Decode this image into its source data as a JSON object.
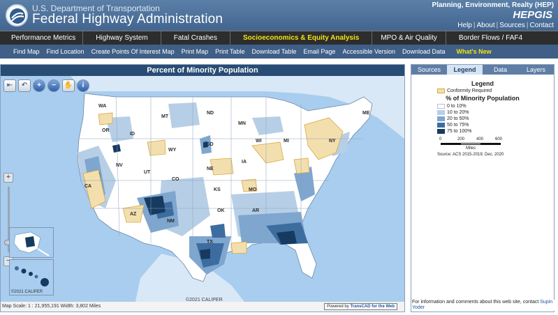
{
  "header": {
    "department": "U.S. Department of Transportation",
    "agency": "Federal Highway Administration",
    "office": "Planning, Environment, Realty (HEP)",
    "app_name": "HEPGIS",
    "links": [
      "Help",
      "About",
      "Sources",
      "Contact"
    ]
  },
  "main_nav": {
    "items": [
      "Performance Metrics",
      "Highway System",
      "Fatal Crashes",
      "Socioeconomics & Equity Analysis",
      "MPO & Air Quality",
      "Border Flows / FAF4"
    ],
    "active": "Socioeconomics & Equity Analysis"
  },
  "tool_nav": {
    "items": [
      "Find Map",
      "Find Location",
      "Create Points Of Interest Map",
      "Print Map",
      "Print Table",
      "Download Table",
      "Email Page",
      "Accessible Version",
      "Download Data"
    ],
    "whats_new": "What's New"
  },
  "map": {
    "title": "Percent of Minority Population",
    "inset_copyright": "©2021 CALIPER",
    "copyright": "©2021 CALIPER",
    "scale_text": "Map Scale: 1 : 21,955,191   Width: 3,802 Miles",
    "powered_by_prefix": "Powered by ",
    "powered_by_product": "TransCAD for the Web",
    "state_labels": [
      "WA",
      "MT",
      "ND",
      "MN",
      "ME",
      "OR",
      "ID",
      "SD",
      "WY",
      "WI",
      "MI",
      "NY",
      "NE",
      "IA",
      "NV",
      "UT",
      "CO",
      "KS",
      "MO",
      "CA",
      "AZ",
      "NM",
      "OK",
      "AR",
      "TX"
    ]
  },
  "panel": {
    "tabs": [
      "Sources",
      "Legend",
      "Data",
      "Layers"
    ],
    "active_tab": "Legend",
    "legend": {
      "title": "Legend",
      "conformity_label": "Conformity Required",
      "subtitle": "% of Minority Population",
      "classes": [
        {
          "label": "0 to 10%",
          "color": "#ffffff"
        },
        {
          "label": "10 to 20%",
          "color": "#b7cfe6"
        },
        {
          "label": "20 to 50%",
          "color": "#7ea6cf"
        },
        {
          "label": "50 to 75%",
          "color": "#3d6d9f"
        },
        {
          "label": "75 to 100%",
          "color": "#163a60"
        }
      ],
      "scale_ticks": [
        "0",
        "200",
        "400",
        "600"
      ],
      "scale_units": "Miles",
      "source": "Source: ACS 2015-2019; Dec. 2020"
    },
    "footer_text": "For information and comments about this web site, contact ",
    "footer_contact": "Supin Yoder"
  },
  "colors": {
    "header_blue": "#4b6f99",
    "nav_dark": "#2d2d2d",
    "tool_nav": "#3f5f87",
    "highlight_yellow": "#f6e312",
    "water": "#a8cdee",
    "conformity_fill": "#f3dfae",
    "conformity_border": "#d9a640"
  }
}
